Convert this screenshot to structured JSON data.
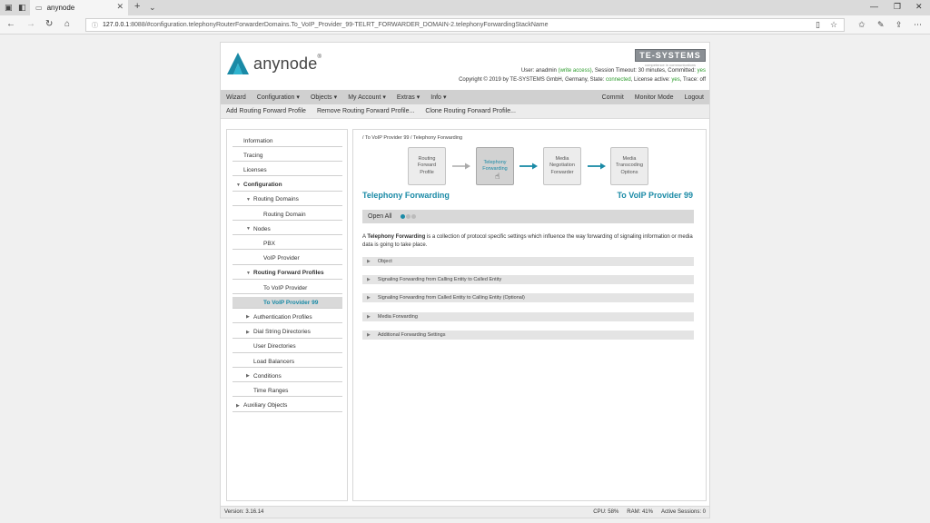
{
  "browser": {
    "tab_title": "anynode",
    "url_host": "127.0.0.1",
    "url_rest": ":8088/#configuration.telephonyRouterForwarderDomains.To_VoIP_Provider_99-TELRT_FORWARDER_DOMAIN-2.telephonyForwardingStackName"
  },
  "header": {
    "logo_text": "anynode",
    "logo_reg": "®",
    "te_logo": "TE-SYSTEMS",
    "te_sub": "competence in communications",
    "user_line_prefix": "User: anadmin",
    "user_access": "(write access)",
    "user_line_mid": ", Session Timeout: 30 minutes, Committed:",
    "committed": "yes",
    "copyright_prefix": "Copyright © 2019 by TE-SYSTEMS GmbH, Germany, State:",
    "state": "connected",
    "license_label": ", License active:",
    "license_active": "yes",
    "trace_label": ", Trace:",
    "trace": "off"
  },
  "menu": {
    "left": [
      {
        "label": "Wizard",
        "dropdown": false
      },
      {
        "label": "Configuration",
        "dropdown": true
      },
      {
        "label": "Objects",
        "dropdown": true
      },
      {
        "label": "My Account",
        "dropdown": true
      },
      {
        "label": "Extras",
        "dropdown": true
      },
      {
        "label": "Info",
        "dropdown": true
      }
    ],
    "right": [
      "Commit",
      "Monitor Mode",
      "Logout"
    ]
  },
  "submenu": [
    "Add Routing Forward Profile",
    "Remove Routing Forward Profile...",
    "Clone Routing Forward Profile..."
  ],
  "sidebar": {
    "items": [
      {
        "label": "Information",
        "indent": 0,
        "tri": "",
        "bold": false,
        "active": false
      },
      {
        "label": "Tracing",
        "indent": 0,
        "tri": "",
        "bold": false,
        "active": false
      },
      {
        "label": "Licenses",
        "indent": 0,
        "tri": "",
        "bold": false,
        "active": false
      },
      {
        "label": "Configuration",
        "indent": 0,
        "tri": "open",
        "bold": true,
        "active": false
      },
      {
        "label": "Routing Domains",
        "indent": 1,
        "tri": "open",
        "bold": false,
        "active": false
      },
      {
        "label": "Routing Domain",
        "indent": 2,
        "tri": "",
        "bold": false,
        "active": false
      },
      {
        "label": "Nodes",
        "indent": 1,
        "tri": "open",
        "bold": false,
        "active": false
      },
      {
        "label": "PBX",
        "indent": 2,
        "tri": "",
        "bold": false,
        "active": false
      },
      {
        "label": "VoIP Provider",
        "indent": 2,
        "tri": "",
        "bold": false,
        "active": false
      },
      {
        "label": "Routing Forward Profiles",
        "indent": 1,
        "tri": "open",
        "bold": true,
        "active": false
      },
      {
        "label": "To VoIP Provider",
        "indent": 2,
        "tri": "",
        "bold": false,
        "active": false
      },
      {
        "label": "To VoIP Provider 99",
        "indent": 2,
        "tri": "",
        "bold": false,
        "active": true
      },
      {
        "label": "Authentication Profiles",
        "indent": 1,
        "tri": "closed",
        "bold": false,
        "active": false
      },
      {
        "label": "Dial String Directories",
        "indent": 1,
        "tri": "closed",
        "bold": false,
        "active": false
      },
      {
        "label": "User Directories",
        "indent": 1,
        "tri": "",
        "bold": false,
        "active": false
      },
      {
        "label": "Load Balancers",
        "indent": 1,
        "tri": "",
        "bold": false,
        "active": false
      },
      {
        "label": "Conditions",
        "indent": 1,
        "tri": "closed",
        "bold": false,
        "active": false
      },
      {
        "label": "Time Ranges",
        "indent": 1,
        "tri": "",
        "bold": false,
        "active": false
      },
      {
        "label": "Auxiliary Objects",
        "indent": 0,
        "tri": "closed",
        "bold": false,
        "active": false
      }
    ]
  },
  "content": {
    "breadcrumb": "/ To VoIP Provider 99 / Telephony Forwarding",
    "flow": [
      {
        "label": "Routing Forward Profile",
        "active": false
      },
      {
        "label": "Telephony Forwarding",
        "active": true
      },
      {
        "label": "Media Negotiation Forwarder",
        "active": false
      },
      {
        "label": "Media Transcoding Options",
        "active": false
      }
    ],
    "flow_arrows": [
      "arrow-gray",
      "arrow-teal",
      "arrow-teal"
    ],
    "title": "Telephony Forwarding",
    "title_right": "To VoIP Provider 99",
    "open_all": "Open All",
    "desc_prefix": "A",
    "desc_bold": "Telephony Forwarding",
    "desc_rest": "is a collection of protocol specific settings which influence the way forwarding of signaling information or media data is going to take place.",
    "sections": [
      "Object",
      "Signaling Forwarding from Calling Entity to Called Entity",
      "Signaling Forwarding from Called Entity to Calling Entity (Optional)",
      "Media Forwarding",
      "Additional Forwarding Settings"
    ]
  },
  "footer": {
    "version": "Version: 3.16.14",
    "cpu": "CPU: 58%",
    "ram": "RAM: 41%",
    "sessions": "Active Sessions: 0"
  },
  "colors": {
    "accent": "#1a8aa6",
    "active_green": "#2a9a2a",
    "menu_bg": "#d0d0d0"
  }
}
